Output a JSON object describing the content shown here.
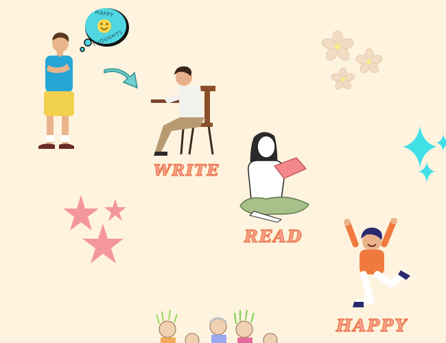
{
  "thought_bubble": {
    "top_text": "HAPPY",
    "bottom_text": "THOUGHTS"
  },
  "words": {
    "write": "WRITE",
    "read": "READ",
    "happy": "HAPPY"
  },
  "colors": {
    "background": "#fdf3df",
    "bubble": "#4fd6e0",
    "arrow": "#6fd0d0",
    "flowers": "#f2dcc4",
    "stars_pink": "#f4979b",
    "stars_cyan": "#3fe0e6",
    "word_fill": "#f6a08a"
  }
}
